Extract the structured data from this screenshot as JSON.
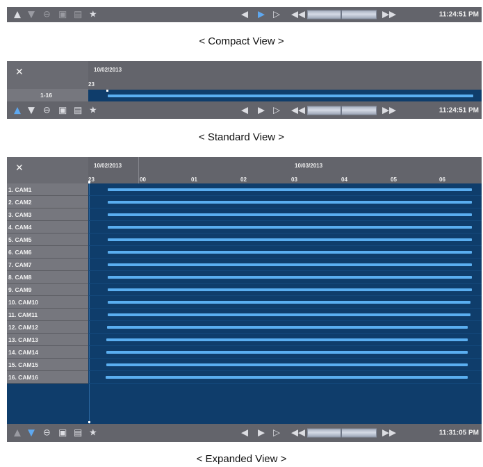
{
  "compact": {
    "caption": "< Compact View >",
    "time": "11:24:51 PM",
    "icons": [
      "up-arrow-icon",
      "down-arrow-icon",
      "zoom-out-icon",
      "calendar-search-icon",
      "bookmark-list-icon",
      "star-icon",
      "rewind-step-icon",
      "play-icon",
      "step-forward-icon",
      "fast-rewind-icon",
      "fast-forward-icon"
    ]
  },
  "standard": {
    "caption": "< Standard View >",
    "date": "10/02/2013",
    "hour": "23",
    "group_label": "1-16",
    "time": "11:24:51 PM"
  },
  "expanded": {
    "caption": "< Expanded View >",
    "date_left": "10/02/2013",
    "date_right": "10/03/2013",
    "hours": [
      "23",
      "00",
      "01",
      "02",
      "03",
      "04",
      "05",
      "06"
    ],
    "cameras": [
      "1. CAM1",
      "2. CAM2",
      "3. CAM3",
      "4. CAM4",
      "5. CAM5",
      "6. CAM6",
      "7. CAM7",
      "8. CAM8",
      "9. CAM9",
      "10. CAM10",
      "11. CAM11",
      "12. CAM12",
      "13. CAM13",
      "14. CAM14",
      "15. CAM15",
      "16. CAM16"
    ],
    "time": "11:31:05 PM"
  },
  "colors": {
    "panel": "#63646b",
    "track": "#0f3d6b",
    "bar": "#5aaef0",
    "highlight": "#5ea8f0"
  }
}
